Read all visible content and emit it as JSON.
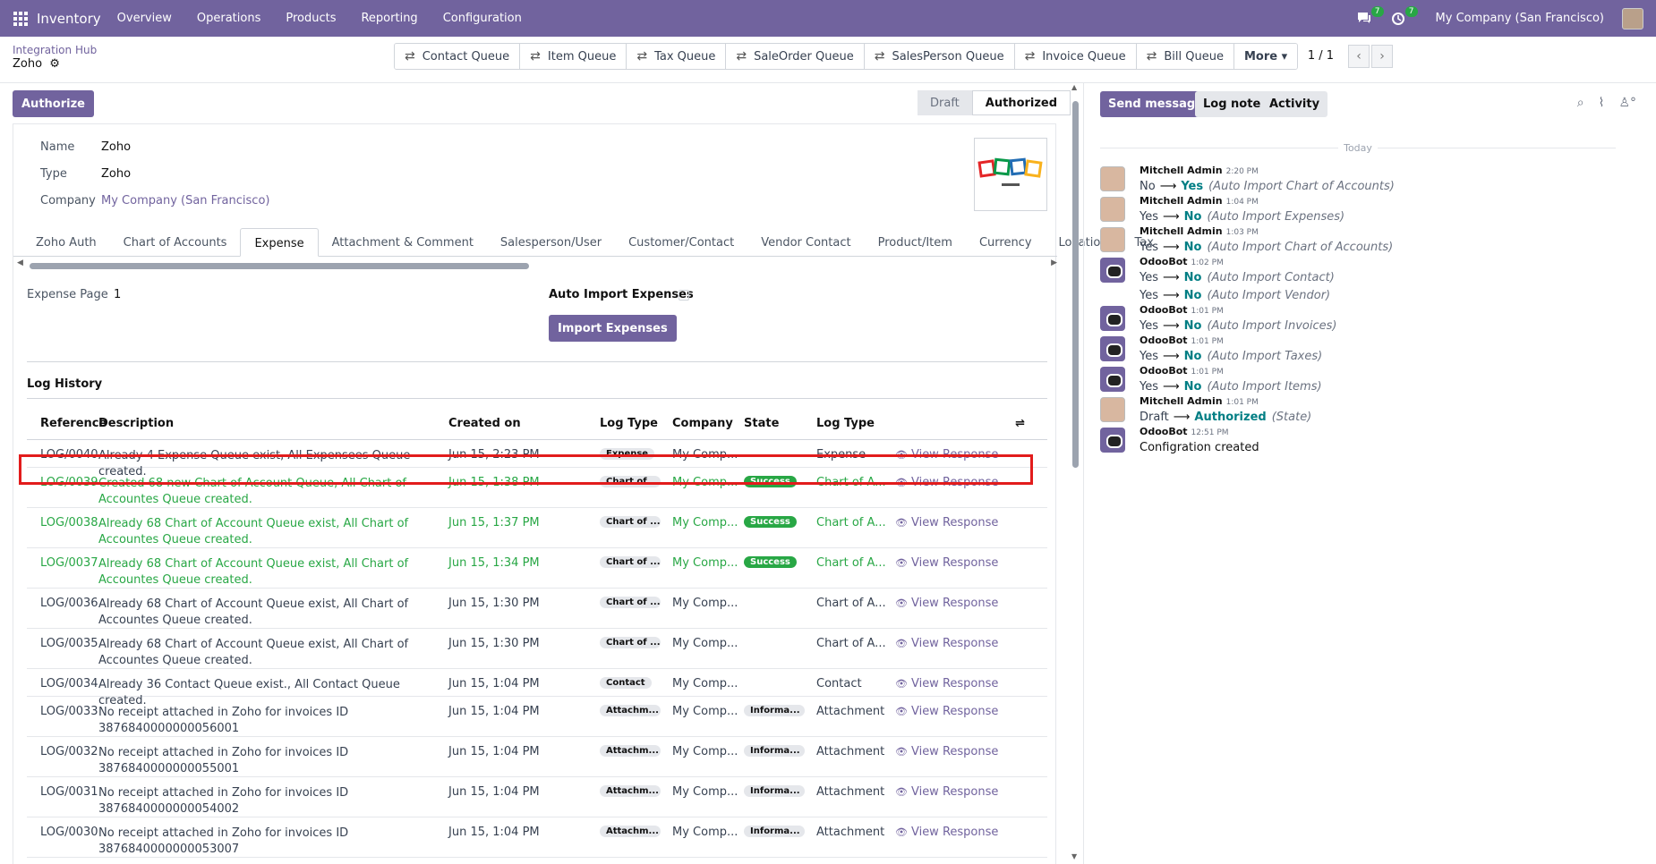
{
  "nav": {
    "app_name": "Inventory",
    "menu": [
      "Overview",
      "Operations",
      "Products",
      "Reporting",
      "Configuration"
    ],
    "messages_badge": "7",
    "activities_badge": "7",
    "company": "My Company (San Francisco)"
  },
  "breadcrumb": {
    "parent": "Integration Hub",
    "current": "Zoho"
  },
  "queues": [
    "Contact Queue",
    "Item Queue",
    "Tax Queue",
    "SaleOrder Queue",
    "SalesPerson Queue",
    "Invoice Queue",
    "Bill Queue",
    "More ▾"
  ],
  "pager": {
    "value": "1 / 1"
  },
  "statusbar": {
    "authorize_label": "Authorize",
    "stages": [
      "Draft",
      "Authorized"
    ],
    "current": "Authorized"
  },
  "form": {
    "name_label": "Name",
    "name_value": "Zoho",
    "type_label": "Type",
    "type_value": "Zoho",
    "company_label": "Company",
    "company_value": "My Company (San Francisco)",
    "tabs": [
      "Zoho Auth",
      "Chart of Accounts",
      "Expense",
      "Attachment & Comment",
      "Salesperson/User",
      "Customer/Contact",
      "Vendor Contact",
      "Product/Item",
      "Currency",
      "Location",
      "Tax"
    ],
    "active_tab": "Expense",
    "expense_page_label": "Expense Page",
    "expense_page_value": "1",
    "auto_import_label": "Auto Import Expenses",
    "auto_import_checked": false,
    "import_button": "Import Expenses",
    "log_history_title": "Log History"
  },
  "logs": {
    "headers": [
      "Reference",
      "Description",
      "Created on",
      "Log Type",
      "Company",
      "State",
      "Log Type"
    ],
    "action_label": "View Response",
    "rows": [
      {
        "ref": "LOG/0040",
        "desc": "Already 4 Expense Queue exist, All Expensees Queue created.",
        "created": "Jun 15, 2:23 PM",
        "type_tag": "Expense",
        "company": "My Comp...",
        "state": "",
        "log_type": "Expense",
        "success": false,
        "highlighted": true
      },
      {
        "ref": "LOG/0039",
        "desc": "Created 68 new Chart of Account Queue, All Chart of Accountes Queue created.",
        "created": "Jun 15, 1:38 PM",
        "type_tag": "Chart of ...",
        "company": "My Comp...",
        "state": "Success",
        "log_type": "Chart of A...",
        "success": true
      },
      {
        "ref": "LOG/0038",
        "desc": "Already 68 Chart of Account Queue exist, All Chart of Accountes Queue created.",
        "created": "Jun 15, 1:37 PM",
        "type_tag": "Chart of ...",
        "company": "My Comp...",
        "state": "Success",
        "log_type": "Chart of A...",
        "success": true
      },
      {
        "ref": "LOG/0037",
        "desc": "Already 68 Chart of Account Queue exist, All Chart of Accountes Queue created.",
        "created": "Jun 15, 1:34 PM",
        "type_tag": "Chart of ...",
        "company": "My Comp...",
        "state": "Success",
        "log_type": "Chart of A...",
        "success": true
      },
      {
        "ref": "LOG/0036",
        "desc": "Already 68 Chart of Account Queue exist, All Chart of Accountes Queue created.",
        "created": "Jun 15, 1:30 PM",
        "type_tag": "Chart of ...",
        "company": "My Comp...",
        "state": "",
        "log_type": "Chart of A...",
        "success": false
      },
      {
        "ref": "LOG/0035",
        "desc": "Already 68 Chart of Account Queue exist, All Chart of Accountes Queue created.",
        "created": "Jun 15, 1:30 PM",
        "type_tag": "Chart of ...",
        "company": "My Comp...",
        "state": "",
        "log_type": "Chart of A...",
        "success": false
      },
      {
        "ref": "LOG/0034",
        "desc": "Already 36 Contact Queue exist., All Contact Queue created.",
        "created": "Jun 15, 1:04 PM",
        "type_tag": "Contact",
        "company": "My Comp...",
        "state": "",
        "log_type": "Contact",
        "success": false
      },
      {
        "ref": "LOG/0033",
        "desc": "No receipt attached in Zoho for invoices ID 3876840000000056001",
        "created": "Jun 15, 1:04 PM",
        "type_tag": "Attachm...",
        "company": "My Comp...",
        "state": "Informa...",
        "log_type": "Attachment",
        "success": false
      },
      {
        "ref": "LOG/0032",
        "desc": "No receipt attached in Zoho for invoices ID 3876840000000055001",
        "created": "Jun 15, 1:04 PM",
        "type_tag": "Attachm...",
        "company": "My Comp...",
        "state": "Informa...",
        "log_type": "Attachment",
        "success": false
      },
      {
        "ref": "LOG/0031",
        "desc": "No receipt attached in Zoho for invoices ID 3876840000000054002",
        "created": "Jun 15, 1:04 PM",
        "type_tag": "Attachm...",
        "company": "My Comp...",
        "state": "Informa...",
        "log_type": "Attachment",
        "success": false
      },
      {
        "ref": "LOG/0030",
        "desc": "No receipt attached in Zoho for invoices ID 3876840000000053007",
        "created": "Jun 15, 1:04 PM",
        "type_tag": "Attachm...",
        "company": "My Comp...",
        "state": "Informa...",
        "log_type": "Attachment",
        "success": false
      }
    ]
  },
  "chatter": {
    "send_message": "Send message",
    "log_note": "Log note",
    "activity": "Activity",
    "day_label": "Today",
    "messages": [
      {
        "author": "Mitchell Admin",
        "time": "2:20 PM",
        "bot": false,
        "changes": [
          {
            "from": "No",
            "to": "Yes",
            "field": "(Auto Import Chart of Accounts)"
          }
        ]
      },
      {
        "author": "Mitchell Admin",
        "time": "1:04 PM",
        "bot": false,
        "changes": [
          {
            "from": "Yes",
            "to": "No",
            "field": "(Auto Import Expenses)"
          }
        ]
      },
      {
        "author": "Mitchell Admin",
        "time": "1:03 PM",
        "bot": false,
        "changes": [
          {
            "from": "Yes",
            "to": "No",
            "field": "(Auto Import Chart of Accounts)"
          }
        ]
      },
      {
        "author": "OdooBot",
        "time": "1:02 PM",
        "bot": true,
        "changes": [
          {
            "from": "Yes",
            "to": "No",
            "field": "(Auto Import Contact)"
          },
          {
            "from": "Yes",
            "to": "No",
            "field": "(Auto Import Vendor)"
          }
        ]
      },
      {
        "author": "OdooBot",
        "time": "1:01 PM",
        "bot": true,
        "changes": [
          {
            "from": "Yes",
            "to": "No",
            "field": "(Auto Import Invoices)"
          }
        ]
      },
      {
        "author": "OdooBot",
        "time": "1:01 PM",
        "bot": true,
        "changes": [
          {
            "from": "Yes",
            "to": "No",
            "field": "(Auto Import Taxes)"
          }
        ]
      },
      {
        "author": "OdooBot",
        "time": "1:01 PM",
        "bot": true,
        "changes": [
          {
            "from": "Yes",
            "to": "No",
            "field": "(Auto Import Items)"
          }
        ]
      },
      {
        "author": "Mitchell Admin",
        "time": "1:01 PM",
        "bot": false,
        "changes": [
          {
            "from": "Draft",
            "to": "Authorized",
            "field": "(State)"
          }
        ]
      },
      {
        "author": "OdooBot",
        "time": "12:51 PM",
        "bot": true,
        "body": "Configration created"
      }
    ]
  }
}
